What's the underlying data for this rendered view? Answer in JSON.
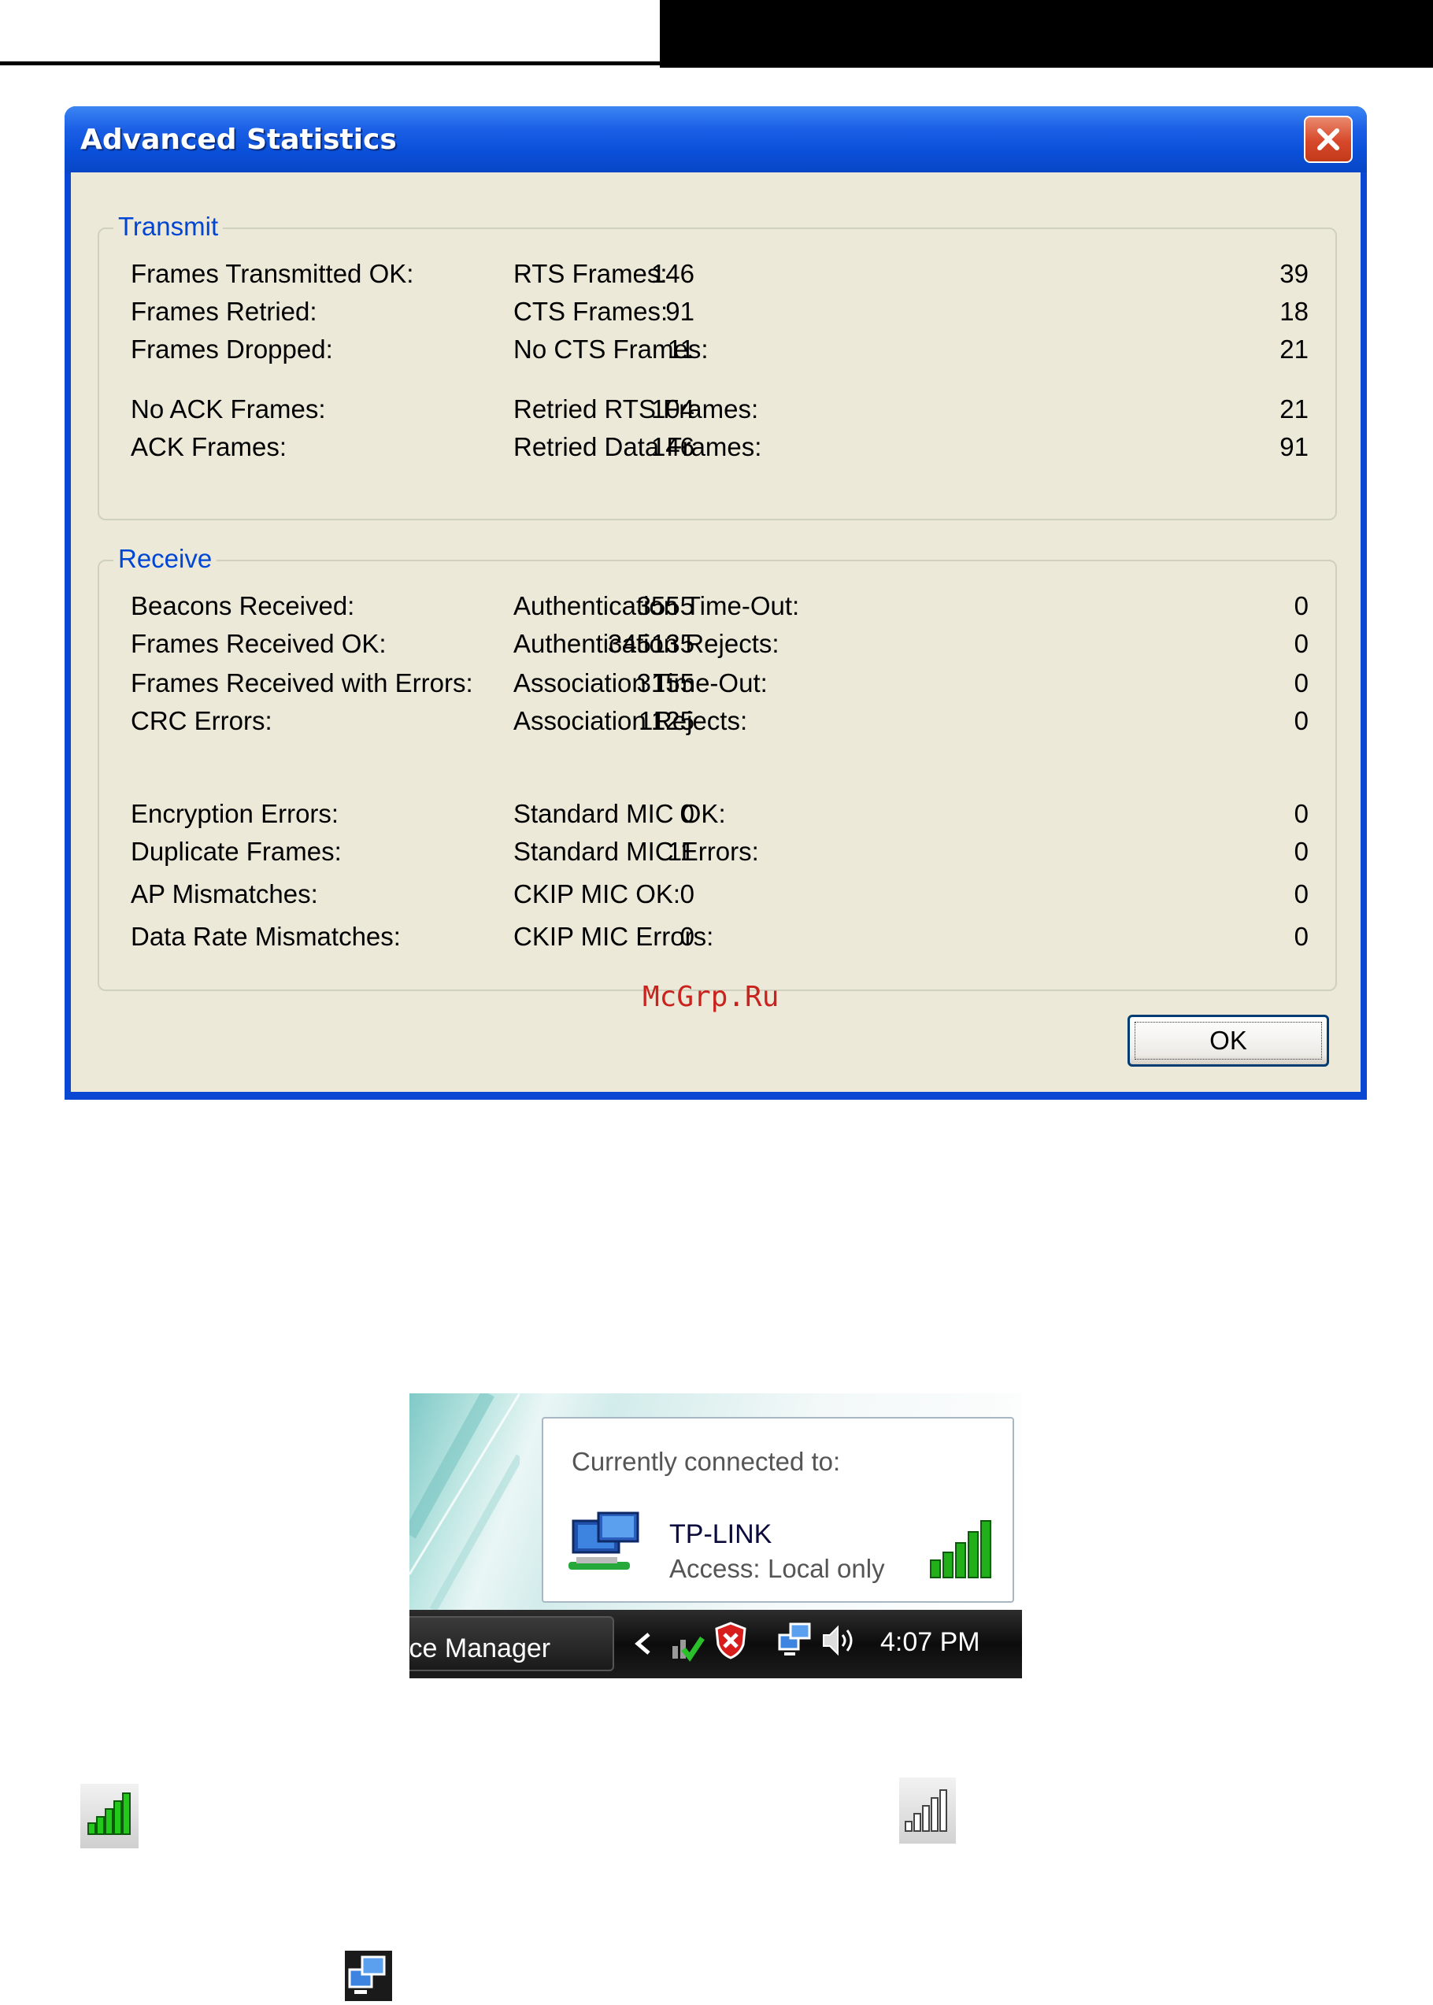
{
  "dialog": {
    "title": "Advanced Statistics",
    "ok_label": "OK",
    "transmit": {
      "legend": "Transmit",
      "left": [
        {
          "label": "Frames Transmitted OK:",
          "value": "146"
        },
        {
          "label": "Frames Retried:",
          "value": "91"
        },
        {
          "label": "Frames Dropped:",
          "value": "11"
        },
        {
          "label": "No ACK Frames:",
          "value": "104"
        },
        {
          "label": "ACK Frames:",
          "value": "146"
        }
      ],
      "right": [
        {
          "label": "RTS Frames:",
          "value": "39"
        },
        {
          "label": "CTS Frames:",
          "value": "18"
        },
        {
          "label": "No CTS Frames:",
          "value": "21"
        },
        {
          "label": "Retried RTS Frames:",
          "value": "21"
        },
        {
          "label": "Retried Data Frames:",
          "value": "91"
        }
      ]
    },
    "receive": {
      "legend": "Receive",
      "left": [
        {
          "label": "Beacons Received:",
          "value": "3555"
        },
        {
          "label": "Frames Received OK:",
          "value": "345135"
        },
        {
          "label": "Frames Received with Errors:",
          "value": "3155"
        },
        {
          "label": "CRC Errors:",
          "value": "1125"
        },
        {
          "label": "Encryption Errors:",
          "value": "0"
        },
        {
          "label": "Duplicate Frames:",
          "value": "11"
        },
        {
          "label": "AP Mismatches:",
          "value": "0"
        },
        {
          "label": "Data Rate Mismatches:",
          "value": "0"
        }
      ],
      "right": [
        {
          "label": "Authentication Time-Out:",
          "value": "0"
        },
        {
          "label": "Authentication Rejects:",
          "value": "0"
        },
        {
          "label": "Association Time-Out:",
          "value": "0"
        },
        {
          "label": "Association Rejects:",
          "value": "0"
        },
        {
          "label": "Standard MIC OK:",
          "value": "0"
        },
        {
          "label": "Standard MIC Errors:",
          "value": "0"
        },
        {
          "label": "CKIP MIC OK:",
          "value": "0"
        },
        {
          "label": "CKIP MIC Errors:",
          "value": "0"
        }
      ]
    }
  },
  "watermark": "McGrp.Ru",
  "tray": {
    "popup_heading": "Currently connected to:",
    "network_name": "TP-LINK",
    "access_label": "Access:",
    "access_value": "Local only",
    "taskbar_button": "ice Manager",
    "clock": "4:07 PM"
  },
  "colors": {
    "title_blue": "#0a47d2",
    "legend_blue": "#0046d5",
    "signal_green": "#22b01a",
    "watermark_red": "#c8231e"
  },
  "icons": [
    "close-icon",
    "network-computer-icon",
    "signal-strength-icon",
    "arrow-left-icon",
    "shield-error-icon",
    "volume-icon",
    "signal-full-icon",
    "signal-none-icon",
    "network-connected-icon"
  ]
}
